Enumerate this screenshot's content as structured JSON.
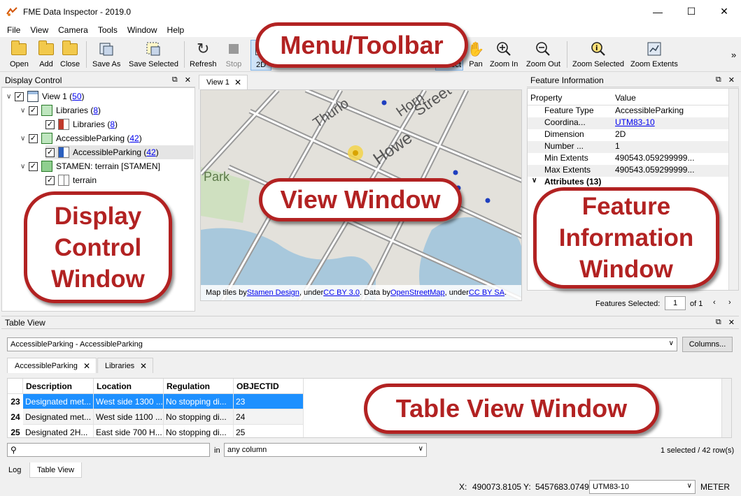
{
  "window": {
    "title": "FME Data Inspector - 2019.0",
    "controls": [
      "—",
      "☐",
      "✕"
    ]
  },
  "menu": [
    "File",
    "View",
    "Camera",
    "Tools",
    "Window",
    "Help"
  ],
  "toolbar": {
    "open": "Open",
    "add": "Add",
    "close": "Close",
    "save_as": "Save As",
    "save_selected": "Save Selected",
    "refresh": "Refresh",
    "stop": "Stop",
    "mode_2d": "2D",
    "select": "Select",
    "pan": "Pan",
    "zoom_in": "Zoom In",
    "zoom_out": "Zoom Out",
    "zoom_selected": "Zoom Selected",
    "zoom_extents": "Zoom Extents",
    "overflow": "»"
  },
  "display_control": {
    "title": "Display Control",
    "items": [
      {
        "label": "View 1 (",
        "count": "50",
        "suffix": " )"
      },
      {
        "label": "Libraries (",
        "count": "8",
        "suffix": " )"
      },
      {
        "label": "Libraries (",
        "count": "8",
        "suffix": " )"
      },
      {
        "label": "AccessibleParking (",
        "count": "42",
        "suffix": " )"
      },
      {
        "label": "AccessibleParking (",
        "count": "42",
        "suffix": " )"
      },
      {
        "label": "STAMEN: terrain [STAMEN]",
        "count": "",
        "suffix": ""
      },
      {
        "label": "terrain",
        "count": "",
        "suffix": ""
      }
    ]
  },
  "view": {
    "tab": "View 1",
    "map_labels": [
      "Thurlo",
      "Horn",
      "Street",
      "Howe",
      "Park"
    ],
    "attribution": {
      "prefix": "Map tiles by ",
      "l1": "Stamen Design",
      "t1": ", under ",
      "l2": "CC BY 3.0",
      "t2": ". Data by ",
      "l3": "OpenStreetMap",
      "t3": ", under ",
      "l4": "CC BY SA",
      "t4": "."
    }
  },
  "feature_info": {
    "title": "Feature Information",
    "col_property": "Property",
    "col_value": "Value",
    "rows": [
      {
        "k": "Feature Type",
        "v": "AccessibleParking"
      },
      {
        "k": "Coordina...",
        "v": "UTM83-10"
      },
      {
        "k": "Dimension",
        "v": "2D"
      },
      {
        "k": "Number ...",
        "v": "1"
      },
      {
        "k": "Min Extents",
        "v": "490543.059299999..."
      },
      {
        "k": "Max Extents",
        "v": "490543.059299999..."
      }
    ],
    "attributes": "Attributes (13)",
    "features_selected_label": "Features Selected:",
    "features_selected_value": "1",
    "features_selected_of": "of 1"
  },
  "table_view": {
    "title": "Table View",
    "dataset": "AccessibleParking - AccessibleParking",
    "columns_button": "Columns...",
    "tabs": [
      "AccessibleParking",
      "Libraries"
    ],
    "headers": [
      "Description",
      "Location",
      "Regulation",
      "OBJECTID"
    ],
    "rows": [
      {
        "n": "23",
        "cells": [
          "Designated met...",
          "West side 1300 ...",
          "No stopping di...",
          "23"
        ]
      },
      {
        "n": "24",
        "cells": [
          "Designated met...",
          "West side 1100 ...",
          "No stopping di...",
          "24"
        ]
      },
      {
        "n": "25",
        "cells": [
          "Designated 2H...",
          "East side 700 H...",
          "No stopping di...",
          "25"
        ]
      }
    ],
    "search_in": "in",
    "search_scope": "any column",
    "selection_status": "1 selected / 42 row(s)"
  },
  "bottom_tabs": [
    "Log",
    "Table View"
  ],
  "status": {
    "x_label": "X:",
    "x_value": "490073.8105",
    "y_label": "Y:",
    "y_value": "5457683.0749",
    "crs": "UTM83-10",
    "units": "METER"
  },
  "callouts": {
    "menu_toolbar": "Menu/Toolbar",
    "display_control": "Display Control Window",
    "view_window": "View Window",
    "feature_info": "Feature Information Window",
    "table_view": "Table View Window"
  },
  "colors": {
    "callout_red": "#b22222",
    "selection_blue": "#1e90ff",
    "map_water": "#a8c8dc",
    "map_land": "#e3e1db",
    "feature_point": "#1f3fbf"
  }
}
